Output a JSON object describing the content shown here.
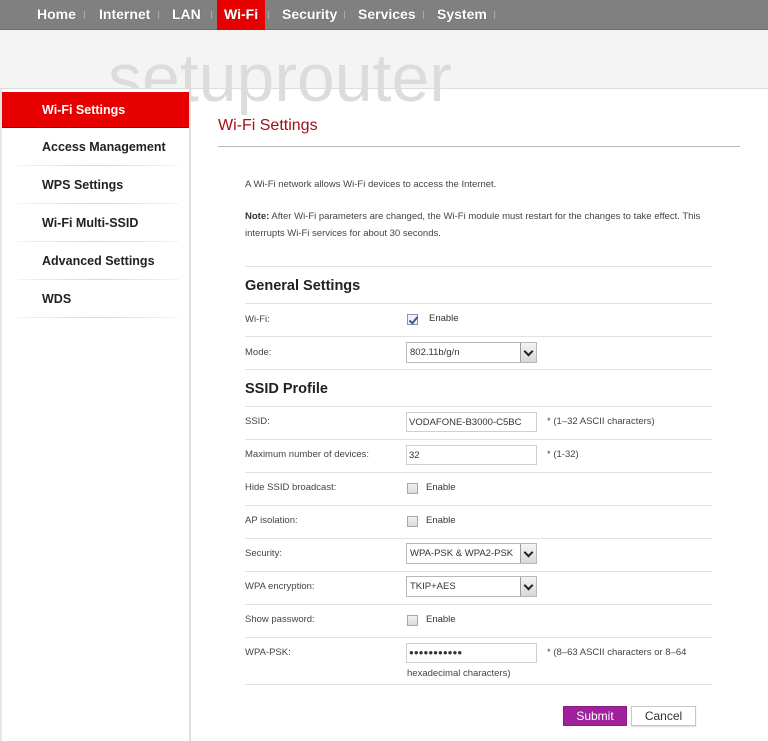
{
  "topnav": {
    "tabs": [
      {
        "label": "Home"
      },
      {
        "label": "Internet"
      },
      {
        "label": "LAN"
      },
      {
        "label": "Wi-Fi",
        "active": true
      },
      {
        "label": "Security"
      },
      {
        "label": "Services"
      },
      {
        "label": "System"
      }
    ]
  },
  "banner": {
    "watermark": "setuprouter"
  },
  "sidebar": {
    "items": [
      {
        "label": "Wi-Fi Settings",
        "active": true
      },
      {
        "label": "Access Management"
      },
      {
        "label": "WPS Settings"
      },
      {
        "label": "Wi-Fi Multi-SSID"
      },
      {
        "label": "Advanced Settings"
      },
      {
        "label": "WDS"
      }
    ]
  },
  "main": {
    "title": "Wi-Fi Settings",
    "intro": "A Wi-Fi network allows Wi-Fi devices to access the Internet.",
    "note_label": "Note:",
    "note_text": " After Wi-Fi parameters are changed, the Wi-Fi module must restart for the changes to take effect. This interrupts Wi-Fi services for about 30 seconds.",
    "general": {
      "heading": "General Settings",
      "wifi_label": "Wi-Fi:",
      "wifi_enable": "Enable",
      "wifi_checked": true,
      "mode_label": "Mode:",
      "mode_value": "802.11b/g/n"
    },
    "ssid_profile": {
      "heading": "SSID Profile",
      "ssid_label": "SSID:",
      "ssid_value": "VODAFONE-B3000-C5BC",
      "ssid_hint": "*   (1–32 ASCII characters)",
      "max_label": "Maximum number of devices:",
      "max_value": "32",
      "max_hint": "*   (1-32)",
      "hide_label": "Hide SSID broadcast:",
      "hide_enable": "Enable",
      "hide_checked": false,
      "ap_label": "AP isolation:",
      "ap_enable": "Enable",
      "ap_checked": false,
      "security_label": "Security:",
      "security_value": "WPA-PSK & WPA2-PSK",
      "enc_label": "WPA encryption:",
      "enc_value": "TKIP+AES",
      "showpw_label": "Show password:",
      "showpw_enable": "Enable",
      "showpw_checked": false,
      "psk_label": "WPA-PSK:",
      "psk_value": "●●●●●●●●●●●",
      "psk_hint": "*   (8–63 ASCII characters or 8–64",
      "psk_hint2": "hexadecimal characters)"
    },
    "buttons": {
      "submit": "Submit",
      "cancel": "Cancel"
    }
  },
  "colors": {
    "accent_red": "#e60000",
    "title_red": "#a40f14",
    "submit_purple": "#a1219d",
    "nav_gray": "#808080"
  }
}
